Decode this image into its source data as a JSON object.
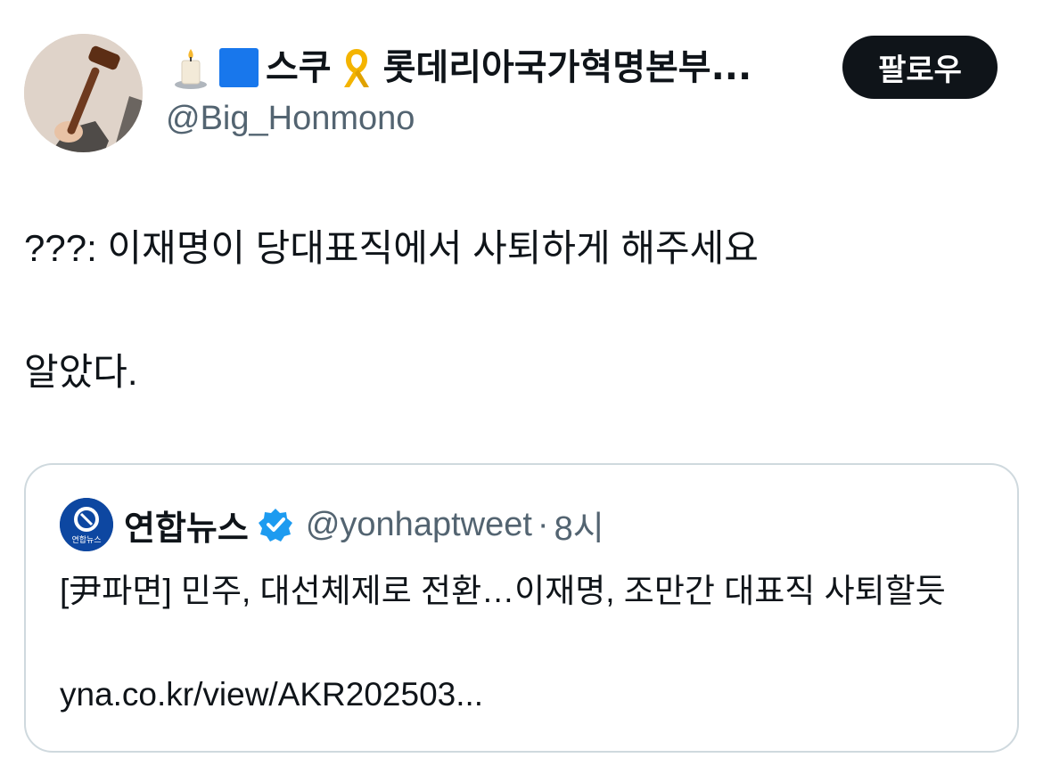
{
  "author": {
    "emoji_prefix": [
      "candle-emoji",
      "blue-square-emoji"
    ],
    "name_part1": "스쿠",
    "emoji_middle": "yellow-ribbon-emoji",
    "name_part2": "롯데리아국가혁명본부...",
    "handle": "@Big_Honmono",
    "avatar_icon": "gavel-avatar"
  },
  "follow_button": {
    "label": "팔로우"
  },
  "tweet": {
    "line1": "???: 이재명이 당대표직에서 사퇴하게 해주세요",
    "line2": "알았다."
  },
  "quote": {
    "name": "연합뉴스",
    "verified_icon": "verified-badge-icon",
    "handle": "@yonhaptweet",
    "separator": "·",
    "time": "8시",
    "avatar_text": "연합뉴스",
    "text": "[尹파면] 민주, 대선체제로 전환…이재명, 조만간 대표직 사퇴할듯",
    "link": "yna.co.kr/view/AKR202503..."
  },
  "colors": {
    "text": "#0f1419",
    "secondary": "#536471",
    "border": "#cfd9de",
    "verified": "#1d9bf0",
    "follow_bg": "#0f1419"
  }
}
